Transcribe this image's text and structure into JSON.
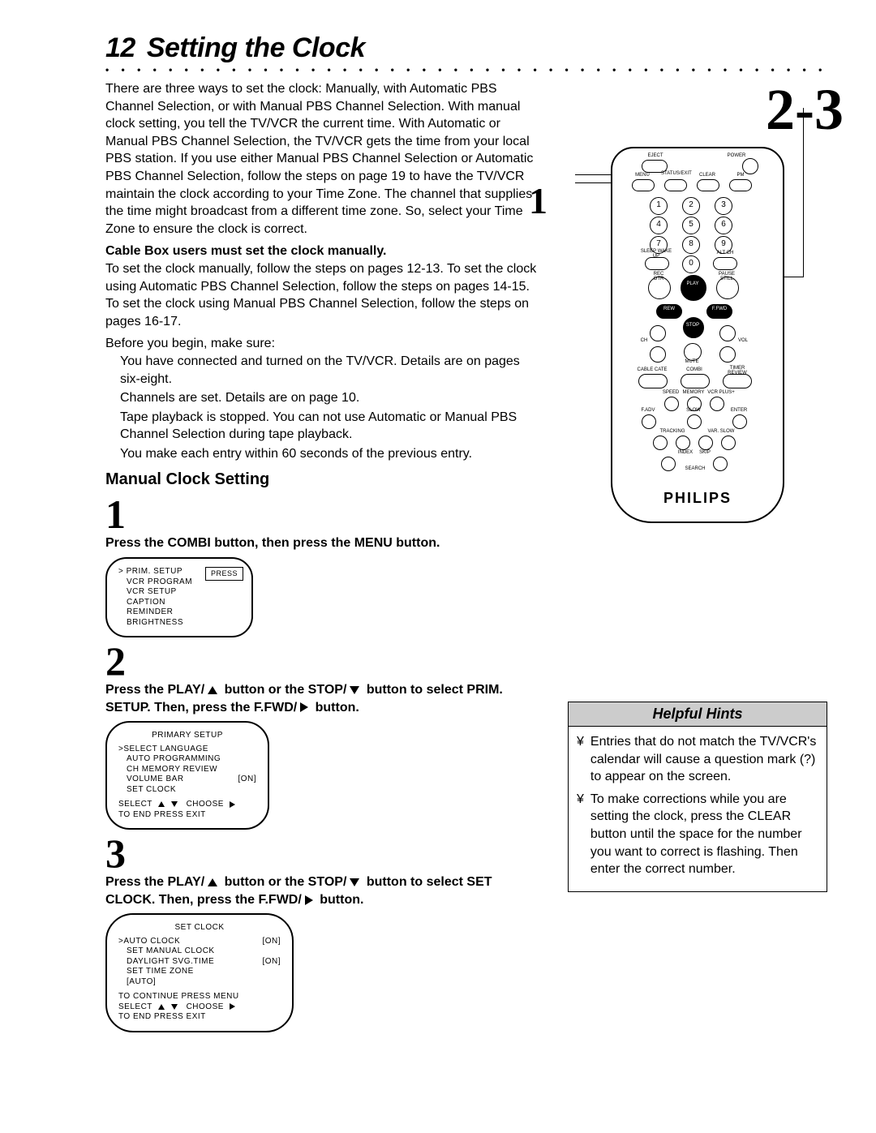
{
  "page_number": "12",
  "title": "Setting the Clock",
  "intro": "There are three ways to set the clock: Manually, with Automatic PBS Channel Selection, or with Manual PBS Channel Selection. With manual clock setting, you tell the TV/VCR the current time. With Automatic or Manual PBS Channel Selection, the TV/VCR gets the time from your local PBS station. If you use either Manual PBS Channel Selection or Automatic PBS Channel Selection, follow the steps on page 19 to have the TV/VCR maintain the clock according to your Time Zone. The channel that supplies the time might broadcast from a different time zone. So, select your Time Zone to ensure the clock is correct.",
  "cablebox_note": "Cable Box users must set the clock manually.",
  "manual_intro": "To set the clock manually, follow the steps on pages 12-13. To set the clock using Automatic PBS Channel Selection, follow the steps on pages 14-15. To set the clock using Manual PBS Channel Selection, follow the steps on pages 16-17.",
  "before_label": "Before you begin, make sure:",
  "before_items": [
    "You have connected and turned on the TV/VCR.  Details are on pages six-eight.",
    "Channels are set.  Details are on page 10.",
    "Tape playback is stopped. You can not use Automatic or Manual PBS Channel Selection during tape playback.",
    "You make each entry within 60 seconds of the previous entry."
  ],
  "manual_heading": "Manual Clock Setting",
  "step1_num": "1",
  "step1_text_a": "Press the COMBI button, then press the MENU button.",
  "screen1": {
    "press": "PRESS",
    "items": [
      "PRIM. SETUP",
      "VCR PROGRAM",
      "VCR SETUP",
      "CAPTION",
      "REMINDER",
      "BRIGHTNESS"
    ]
  },
  "step2_num": "2",
  "step2_a": "Press the PLAY/",
  "step2_b": " button or the STOP/",
  "step2_c": " button to select PRIM. SETUP.  Then, press the F.FWD/",
  "step2_d": " button.",
  "screen2": {
    "title": "PRIMARY SETUP",
    "rows": [
      {
        "l": "SELECT LANGUAGE",
        "r": "",
        "sel": true
      },
      {
        "l": "AUTO PROGRAMMING",
        "r": ""
      },
      {
        "l": "CH MEMORY REVIEW",
        "r": ""
      },
      {
        "l": "VOLUME BAR",
        "r": "[ON]"
      },
      {
        "l": "SET CLOCK",
        "r": ""
      }
    ],
    "foot_a": "SELECT",
    "foot_b": "CHOOSE",
    "foot_c": "TO END  PRESS  EXIT"
  },
  "step3_num": "3",
  "step3_a": "Press the PLAY/",
  "step3_b": " button or the STOP/",
  "step3_c": " button to select SET CLOCK.  Then, press the F.FWD/",
  "step3_d": " button.",
  "screen3": {
    "title": "SET CLOCK",
    "rows": [
      {
        "l": "AUTO CLOCK",
        "r": "[ON]",
        "sel": true
      },
      {
        "l": "SET MANUAL CLOCK",
        "r": ""
      },
      {
        "l": "DAYLIGHT SVG.TIME",
        "r": "[ON]"
      },
      {
        "l": "SET TIME ZONE",
        "r": ""
      },
      {
        "l": "[AUTO]",
        "r": ""
      }
    ],
    "foot_pre": "TO CONTINUE PRESS MENU",
    "foot_a": "SELECT",
    "foot_b": "CHOOSE",
    "foot_c": "TO END  PRESS  EXIT"
  },
  "callout_23": "2-3",
  "callout_1": "1",
  "remote": {
    "brand": "PHILIPS",
    "labels": {
      "eject": "EJECT",
      "power": "POWER",
      "menu": "MENU",
      "status_exit": "STATUS/EXIT",
      "clear": "CLEAR",
      "pm": "PM",
      "sleep_wakeup": "SLEEP WAKE UP",
      "altch": "ALT CH",
      "rec_otr": "REC OTR",
      "play": "PLAY",
      "pause_still": "PAUSE STILL",
      "rew": "REW",
      "ffwd": "F.FWD",
      "stop": "STOP",
      "ch": "CH",
      "mute": "MUTE",
      "vol": "VOL",
      "cable_cate": "CABLE CATE",
      "combi": "COMBI",
      "timer_review": "TIMER REVIEW",
      "speed": "SPEED",
      "memory": "MEMORY",
      "vcrplus": "VCR PLUS+",
      "fadv": "F.ADV",
      "slow": "SLOW",
      "enter": "ENTER",
      "tracking": "TRACKING",
      "varslow": "VAR. SLOW",
      "index": "INDEX",
      "skip": "SKIP",
      "search": "SEARCH"
    },
    "digits": [
      "1",
      "2",
      "3",
      "4",
      "5",
      "6",
      "7",
      "8",
      "9",
      "0"
    ]
  },
  "hints": {
    "title": "Helpful Hints",
    "bullets": [
      "Entries that do not match the TV/VCR's calendar will cause a question mark (?) to appear on the screen.",
      "To make corrections while you are setting the clock, press the CLEAR button until the space for the number you want to correct is flashing. Then enter the correct number."
    ],
    "bullet_symbol": "¥"
  }
}
